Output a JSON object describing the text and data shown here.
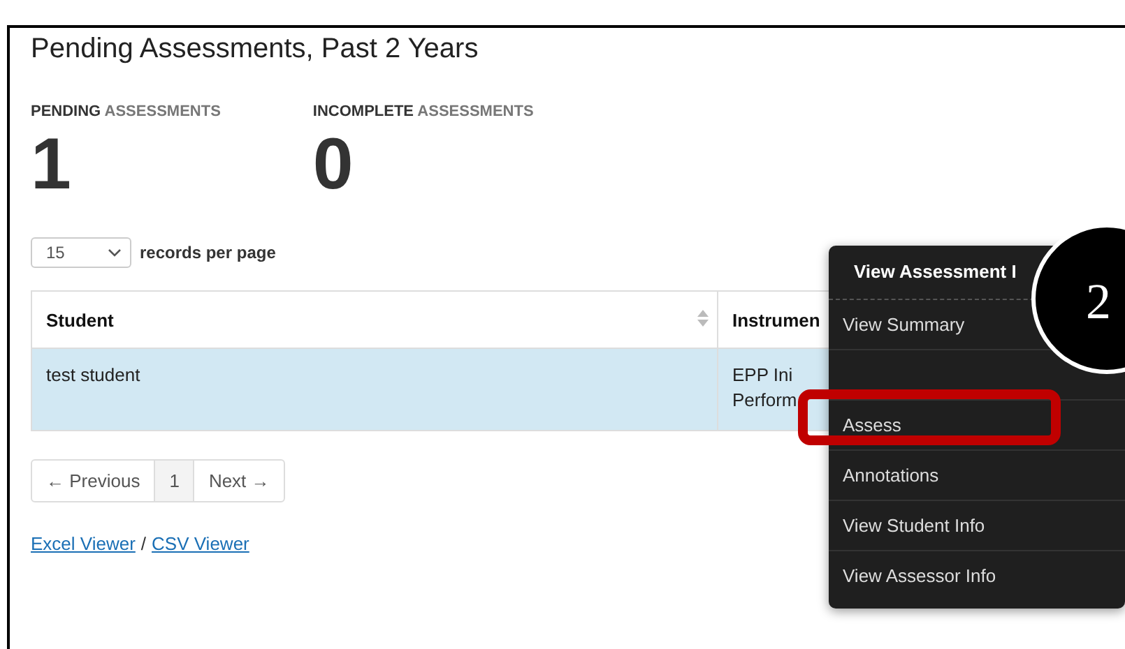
{
  "page": {
    "title": "Pending Assessments, Past 2 Years"
  },
  "stats": [
    {
      "label_main": "PENDING",
      "label_sub": "ASSESSMENTS",
      "value": "1"
    },
    {
      "label_main": "INCOMPLETE",
      "label_sub": "ASSESSMENTS",
      "value": "0"
    }
  ],
  "page_size": {
    "value": "15",
    "label": "records per page"
  },
  "table": {
    "columns": [
      {
        "label": "Student",
        "sortable": true
      },
      {
        "label": "Instrumen",
        "sortable": false
      }
    ],
    "rows": [
      {
        "selected": true,
        "cells": [
          "test student",
          "EPP Ini\nPerform"
        ]
      }
    ]
  },
  "pagination": {
    "previous": "← Previous",
    "pages": [
      {
        "label": "1",
        "selected": true
      }
    ],
    "next": "Next →"
  },
  "exports": [
    {
      "label": "Excel Viewer"
    },
    {
      "label": "CSV Viewer"
    }
  ],
  "export_separator": "/",
  "context_menu": {
    "header": "View Assessment I",
    "items": [
      {
        "label": "View Summary",
        "highlighted": false
      },
      {
        "highlighted": false
      },
      {
        "label": "Assess",
        "highlighted": true
      },
      {
        "label": "Annotations",
        "highlighted": false
      },
      {
        "label": "View Student Info",
        "highlighted": false
      },
      {
        "label": "View Assessor Info",
        "highlighted": false
      }
    ]
  },
  "step_marker": {
    "label": "2"
  }
}
